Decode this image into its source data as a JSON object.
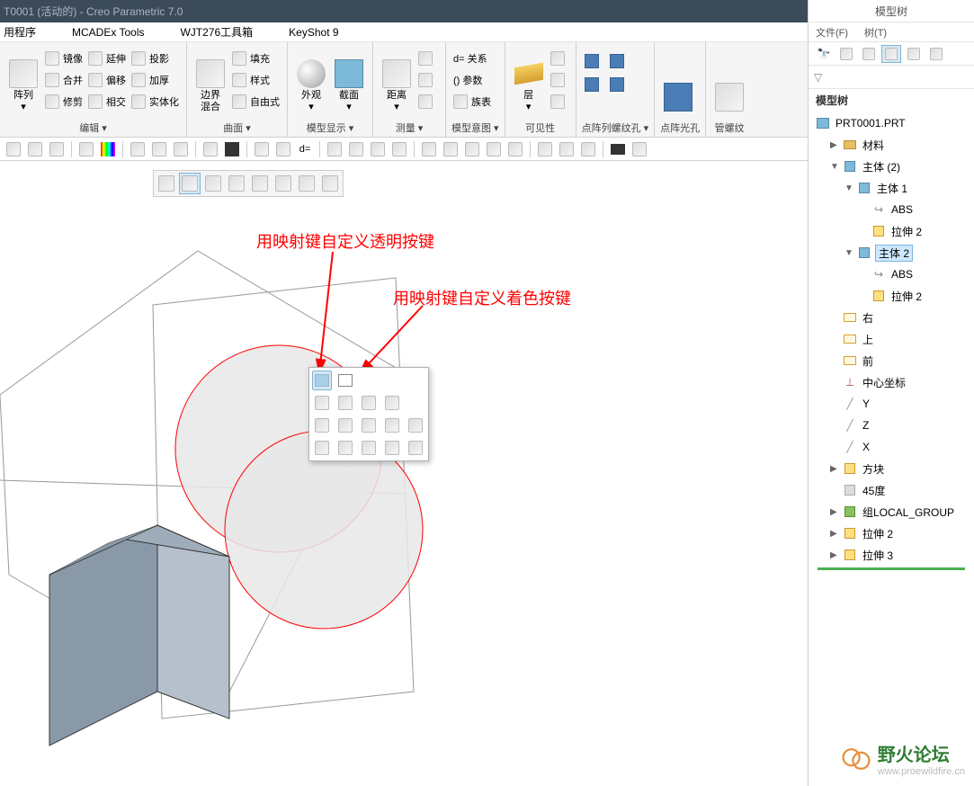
{
  "titlebar": {
    "text": "T0001 (活动的) - Creo Parametric 7.0"
  },
  "menubar": {
    "items": [
      "用程序",
      "MCADEx Tools",
      "WJT276工具箱",
      "KeyShot 9"
    ]
  },
  "ribbon": {
    "groups": [
      {
        "label": "编辑 ▾",
        "big": [
          {
            "label": "阵列\n▾"
          }
        ],
        "cols": [
          [
            "镜像",
            "合并",
            "修剪"
          ],
          [
            "延伸",
            "偏移",
            "相交"
          ],
          [
            "投影",
            "加厚",
            "实体化"
          ]
        ]
      },
      {
        "label": "曲面 ▾",
        "big": [
          {
            "label": "边界\n混合"
          }
        ],
        "cols": [
          [
            "填充",
            "样式",
            "自由式"
          ]
        ]
      },
      {
        "label": "模型显示 ▾",
        "big": [
          {
            "label": "外观\n▾"
          },
          {
            "label": "截面\n▾"
          }
        ]
      },
      {
        "label": "测量 ▾",
        "big": [
          {
            "label": "距离\n▾"
          }
        ],
        "icons_grid": true
      },
      {
        "label": "模型意图 ▾",
        "cols": [
          [
            "d= 关系",
            "() 参数",
            "族表"
          ]
        ]
      },
      {
        "label": "可见性",
        "big": [
          {
            "label": "层\n▾"
          }
        ],
        "extra_icons": true
      },
      {
        "label": "点阵列螺纹孔 ▾",
        "icon_grid_2x2": true
      },
      {
        "label": "点阵光孔",
        "single_icon": true
      },
      {
        "label": "管螺纹",
        "single_icon": true
      }
    ]
  },
  "quickbar": {
    "d_label": "d="
  },
  "floating_toolbar": {
    "items": 8
  },
  "annotations": {
    "a1": "用映射键自定义透明按键",
    "a2": "用映射键自定义着色按键"
  },
  "right_panel": {
    "title": "模型树",
    "tabs": [
      "文件(F)",
      "树(T)"
    ],
    "heading": "模型树",
    "tree": {
      "root": "PRT0001.PRT",
      "items": [
        {
          "label": "材料",
          "depth": 1,
          "arrow": "▶",
          "icon": "deck"
        },
        {
          "label": "主体 (2)",
          "depth": 1,
          "arrow": "▼",
          "icon": "cube"
        },
        {
          "label": "主体 1",
          "depth": 2,
          "arrow": "▼",
          "icon": "cube"
        },
        {
          "label": "ABS",
          "depth": 3,
          "icon": "turn"
        },
        {
          "label": "拉伸 2",
          "depth": 3,
          "icon": "extrude"
        },
        {
          "label": "主体 2",
          "depth": 2,
          "arrow": "▼",
          "icon": "cube",
          "selected": true
        },
        {
          "label": "ABS",
          "depth": 3,
          "icon": "turn"
        },
        {
          "label": "拉伸 2",
          "depth": 3,
          "icon": "extrude"
        },
        {
          "label": "右",
          "depth": 1,
          "icon": "plane"
        },
        {
          "label": "上",
          "depth": 1,
          "icon": "plane"
        },
        {
          "label": "前",
          "depth": 1,
          "icon": "plane"
        },
        {
          "label": "中心坐标",
          "depth": 1,
          "icon": "csys"
        },
        {
          "label": "Y",
          "depth": 1,
          "icon": "axis"
        },
        {
          "label": "Z",
          "depth": 1,
          "icon": "axis"
        },
        {
          "label": "X",
          "depth": 1,
          "icon": "axis"
        },
        {
          "label": "方块",
          "depth": 1,
          "arrow": "▶",
          "icon": "extrude"
        },
        {
          "label": "45度",
          "depth": 1,
          "icon": "extrude-gray"
        },
        {
          "label": "组LOCAL_GROUP",
          "depth": 1,
          "arrow": "▶",
          "icon": "group"
        },
        {
          "label": "拉伸 2",
          "depth": 1,
          "arrow": "▶",
          "icon": "extrude"
        },
        {
          "label": "拉伸 3",
          "depth": 1,
          "arrow": "▶",
          "icon": "extrude"
        }
      ]
    }
  },
  "watermark": {
    "title": "野火论坛",
    "url": "www.proewildfire.cn"
  }
}
